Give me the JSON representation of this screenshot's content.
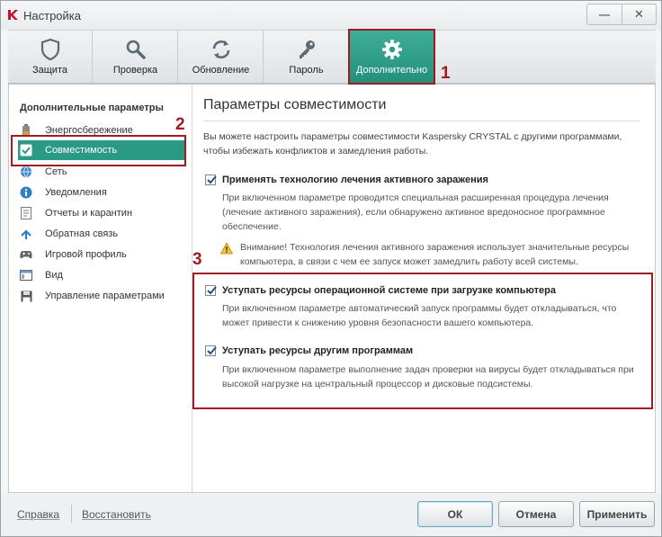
{
  "window": {
    "title": "Настройка",
    "minimize_glyph": "—",
    "close_glyph": "✕"
  },
  "toolbar": {
    "tabs": [
      {
        "label": "Защита",
        "icon": "shield-icon",
        "active": false
      },
      {
        "label": "Проверка",
        "icon": "search-icon",
        "active": false
      },
      {
        "label": "Обновление",
        "icon": "refresh-icon",
        "active": false
      },
      {
        "label": "Пароль",
        "icon": "key-icon",
        "active": false
      },
      {
        "label": "Дополнительно",
        "icon": "gear-icon",
        "active": true
      }
    ]
  },
  "sidebar": {
    "heading": "Дополнительные параметры",
    "items": [
      {
        "label": "Энергосбережение",
        "icon": "battery-icon",
        "selected": false
      },
      {
        "label": "Совместимость",
        "icon": "compatibility-check-icon",
        "selected": true
      },
      {
        "label": "Сеть",
        "icon": "network-icon",
        "selected": false
      },
      {
        "label": "Уведомления",
        "icon": "info-icon",
        "selected": false
      },
      {
        "label": "Отчеты и карантин",
        "icon": "reports-icon",
        "selected": false
      },
      {
        "label": "Обратная связь",
        "icon": "feedback-icon",
        "selected": false
      },
      {
        "label": "Игровой профиль",
        "icon": "gamepad-icon",
        "selected": false
      },
      {
        "label": "Вид",
        "icon": "window-view-icon",
        "selected": false
      },
      {
        "label": "Управление параметрами",
        "icon": "save-icon",
        "selected": false
      }
    ]
  },
  "pane": {
    "title": "Параметры совместимости",
    "intro": "Вы можете настроить параметры совместимости Kaspersky CRYSTAL с другими программами, чтобы избежать конфликтов и замедления работы.",
    "options": [
      {
        "label": "Применять технологию лечения активного заражения",
        "checked": true,
        "description": "При включенном параметре проводится специальная расширенная процедура лечения (лечение активного заражения), если обнаружено активное вредоносное программное обеспечение."
      },
      {
        "label": "Уступать ресурсы операционной системе при загрузке компьютера",
        "checked": true,
        "description": "При включенном параметре автоматический запуск программы будет откладываться, что может привести к снижению уровня безопасности вашего компьютера."
      },
      {
        "label": "Уступать ресурсы другим программам",
        "checked": true,
        "description": "При включенном параметре выполнение задач проверки на вирусы будет откладываться при высокой нагрузке на центральный процессор и дисковые подсистемы."
      }
    ],
    "warning": "Внимание! Технология лечения активного заражения использует значительные ресурсы компьютера, в связи с чем ее запуск может замедлить работу всей системы."
  },
  "annotations": [
    "1",
    "2",
    "3"
  ],
  "footer": {
    "help_link": "Справка",
    "restore_link": "Восстановить",
    "ok_button": "ОК",
    "cancel_button": "Отмена",
    "apply_button": "Применить"
  },
  "colors": {
    "accent": "#2a9a84",
    "annotation": "#a11a22"
  }
}
